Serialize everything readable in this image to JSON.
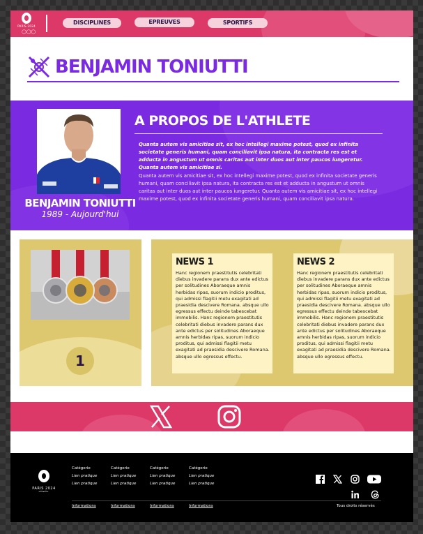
{
  "header": {
    "logo_text": "PARIS 2024",
    "nav": [
      "DISCIPLINES",
      "EPREUVES",
      "SPORTIFS"
    ]
  },
  "athlete": {
    "name": "BENJAMIN TONIUTTI",
    "card_name": "BENJAMIN TONIUTTI",
    "years": "1989 - Aujourd'hui"
  },
  "about": {
    "title": "A PROPOS DE L'ATHLETE",
    "bold_text": "Quanta autem vis amicitiae sit, ex hoc intellegi maxime potest, quod ex  infinita societate generis humani, quam conciliavit ipsa natura, ita  contracta res est et adducta in angustum ut omnis caritas aut inter duos aut inter paucos iungeretur. Quanta autem vis amicitiae si.",
    "text": "Quanta autem vis amicitiae sit, ex hoc intellegi maxime potest, quod ex  infinita societate generis humani, quam conciliavit ipsa natura, ita  contracta res est et adducta in angustum ut omnis caritas aut inter duos aut inter paucos iungeretur. Quanta autem vis amicitiae sit, ex hoc intellegi maxime potest, quod ex infinita societate generis humani, quam conciliavit ipsa natura."
  },
  "medals": {
    "count": "1"
  },
  "news": [
    {
      "title": "NEWS 1",
      "body": "Hanc regionem praestitutis celebritati diebus invadere parans dux ante  edictus per solitudines Aboraeque amnis herbidas ripas, suorum indicio  proditus, qui admissi flagitii metu exagitati ad praesidia descivere  Romana. absque ullo egressus effectu deinde tabescebat immobilis. Hanc regionem praestitutis celebritati diebus invadere parans dux ante  edictus per solitudines Aboraeque amnis herbidas ripas, suorum indicio  proditus, qui admissi flagitii metu exagitati ad praesidia descivere  Romana. absque ullo egressus effectu."
    },
    {
      "title": "NEWS 2",
      "body": "Hanc regionem praestitutis celebritati diebus invadere parans dux ante  edictus per solitudines Aboraeque amnis herbidas ripas, suorum indicio  proditus, qui admissi flagitii metu exagitati ad praesidia descivere  Romana. absque ullo egressus effectu deinde tabescebat immobilis. Hanc regionem praestitutis celebritati diebus invadere parans dux ante  edictus per solitudines Aboraeque amnis herbidas ripas, suorum indicio  proditus, qui admissi flagitii metu exagitati ad praesidia descivere  Romana. absque ullo egressus effectu."
    }
  ],
  "social": [
    "x-icon",
    "instagram-icon"
  ],
  "footer": {
    "logo_text": "PARIS 2024",
    "columns": [
      {
        "heading": "Catégorie",
        "links": [
          "Lien pratique",
          "Lien pratique"
        ]
      },
      {
        "heading": "Catégorie",
        "links": [
          "Lien pratique",
          "Lien pratique"
        ]
      },
      {
        "heading": "Catégorie",
        "links": [
          "Lien pratique",
          "Lien pratique"
        ]
      },
      {
        "heading": "Catégorie",
        "links": [
          "Lien pratique",
          "Lien pratique"
        ]
      }
    ],
    "info_links": [
      "Informations",
      "Informations",
      "Informations",
      "Informations"
    ],
    "rights": "Tous droits réservés",
    "icons": [
      "facebook-icon",
      "x-icon",
      "instagram-icon",
      "youtube-icon",
      "linkedin-icon",
      "threads-icon"
    ]
  },
  "colors": {
    "pink": "#dc3868",
    "purple": "#7a2be2",
    "gold": "#ddc870",
    "card": "#fdf3c4"
  }
}
